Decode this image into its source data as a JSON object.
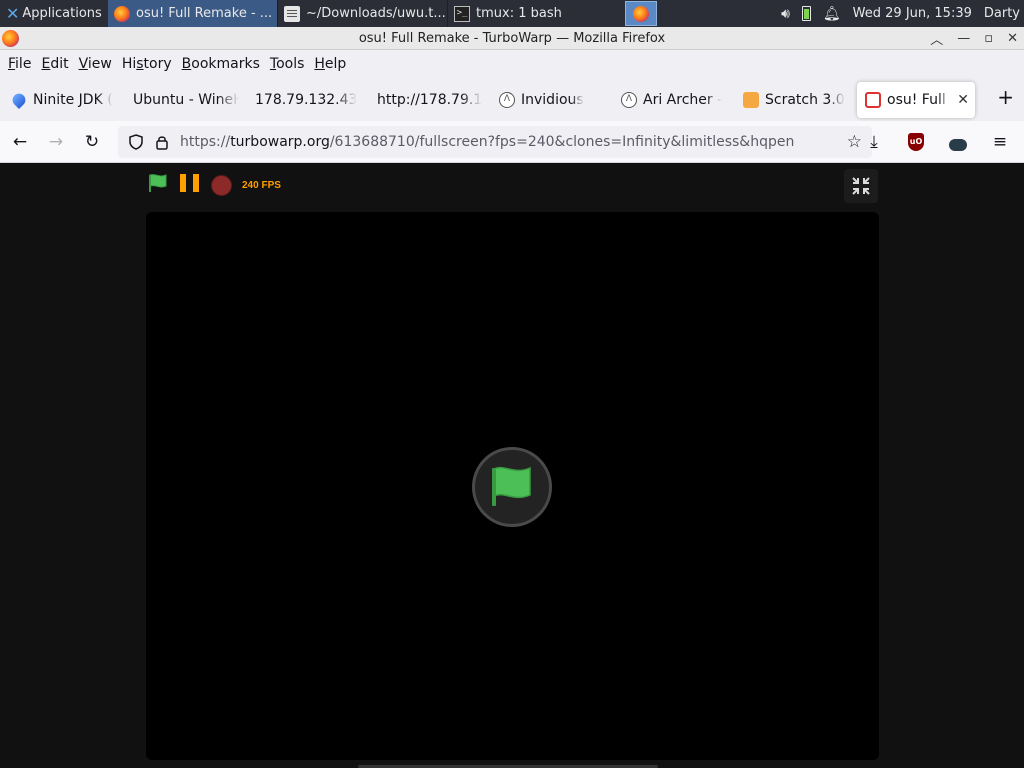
{
  "panel": {
    "apps_label": "Applications",
    "tasks": [
      {
        "label": "osu! Full Remake - ...",
        "icon": "firefox-icon"
      },
      {
        "label": "~/Downloads/uwu.t...",
        "icon": "document-icon"
      },
      {
        "label": "tmux: 1 bash",
        "icon": "terminal-icon"
      }
    ],
    "clock": "Wed 29 Jun, 15:39",
    "user": "Darty"
  },
  "window": {
    "title": "osu! Full Remake - TurboWarp — Mozilla Firefox"
  },
  "menu": {
    "items": [
      {
        "pre": "",
        "u": "F",
        "post": "ile"
      },
      {
        "pre": "",
        "u": "E",
        "post": "dit"
      },
      {
        "pre": "",
        "u": "V",
        "post": "iew"
      },
      {
        "pre": "Hi",
        "u": "s",
        "post": "tory"
      },
      {
        "pre": "",
        "u": "B",
        "post": "ookmarks"
      },
      {
        "pre": "",
        "u": "T",
        "post": "ools"
      },
      {
        "pre": "",
        "u": "H",
        "post": "elp"
      }
    ]
  },
  "tabs": [
    {
      "label": "Ninite JDK (",
      "icon": "ninite-icon"
    },
    {
      "label": "Ubuntu - WineH",
      "icon": ""
    },
    {
      "label": "178.79.132.43",
      "icon": ""
    },
    {
      "label": "http://178.79.1",
      "icon": ""
    },
    {
      "label": "Invidious",
      "icon": "invidious-icon"
    },
    {
      "label": "Ari Archer -",
      "icon": "invidious-icon"
    },
    {
      "label": "Scratch 3.0",
      "icon": "scratch-cat-icon"
    },
    {
      "label": "osu! Full R",
      "icon": "turbowarp-icon",
      "selected": true
    }
  ],
  "nav": {
    "url_prefix": "https://",
    "url_host": "turbowarp.org",
    "url_rest": "/613688710/fullscreen?fps=240&clones=Infinity&limitless&hqpen"
  },
  "player": {
    "fps_label": "240 FPS",
    "colors": {
      "flag": "#4cbf56",
      "pause": "#ff9f00",
      "stop": "#8c2a2a"
    }
  }
}
